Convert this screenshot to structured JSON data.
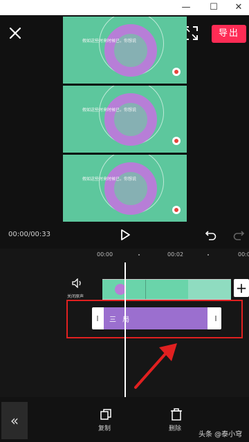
{
  "window": {
    "minimize": "—",
    "maximize": "☐",
    "close": "✕"
  },
  "header": {
    "close_icon": "close-icon",
    "fullscreen_icon": "fullscreen-icon",
    "export_label": "导出",
    "export_color": "#fe2c55"
  },
  "preview": {
    "frame_caption": "假如这些时来时候已，你想说",
    "frames": 3,
    "timecode": "00:00/00:33",
    "play_icon": "play-icon",
    "undo_icon": "undo-icon",
    "redo_icon": "redo-icon"
  },
  "timeline": {
    "ticks": [
      "00:00",
      "00:02",
      "00:0"
    ],
    "audio_icon": "volume-icon",
    "audio_label": "关闭原声",
    "add_icon": "+",
    "text_clip_label": "三 局",
    "text_clip_color": "#9b6fcf",
    "highlight_color": "#e02020"
  },
  "bottom_bar": {
    "collapse_label": "«",
    "tools": [
      {
        "label": "复制",
        "icon": "copy-icon"
      },
      {
        "label": "删除",
        "icon": "delete-icon"
      }
    ],
    "watermark": "头条 @泰小穹"
  }
}
